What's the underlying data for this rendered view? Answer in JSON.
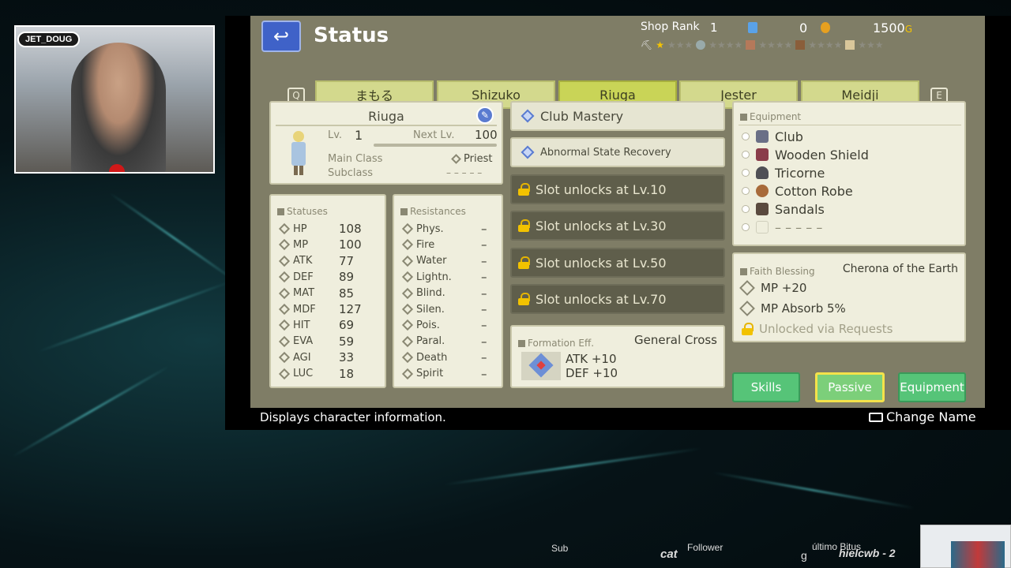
{
  "stream": {
    "cam_name": "JET_DOUG",
    "footer": {
      "sub": "Sub",
      "cat": "cat",
      "follower": "Follower",
      "g": "g",
      "ultimo": "último Bitus",
      "name": "hielcwb - 2"
    }
  },
  "game": {
    "title": "Status",
    "shop": {
      "label": "Shop Rank",
      "rank": "1",
      "gems": "0",
      "gold": "1500",
      "gold_unit": "G"
    },
    "tabs": [
      {
        "label": "まもる",
        "key": ""
      },
      {
        "label": "Shizuko"
      },
      {
        "label": "Riuga",
        "active": true
      },
      {
        "label": "Jester"
      },
      {
        "label": "Meidji"
      }
    ],
    "tab_prev_key": "Q",
    "tab_next_key": "E",
    "character": {
      "name": "Riuga",
      "lv_label": "Lv.",
      "lv": "1",
      "next_label": "Next Lv.",
      "next": "100",
      "main_class_label": "Main Class",
      "main_class": "Priest",
      "subclass_label": "Subclass",
      "subclass": "– – – – –"
    },
    "statuses": {
      "header": "Statuses",
      "rows": [
        {
          "name": "HP",
          "value": "108"
        },
        {
          "name": "MP",
          "value": "100"
        },
        {
          "name": "ATK",
          "value": "77"
        },
        {
          "name": "DEF",
          "value": "89"
        },
        {
          "name": "MAT",
          "value": "85"
        },
        {
          "name": "MDF",
          "value": "127"
        },
        {
          "name": "HIT",
          "value": "69"
        },
        {
          "name": "EVA",
          "value": "59"
        },
        {
          "name": "AGI",
          "value": "33"
        },
        {
          "name": "LUC",
          "value": "18"
        }
      ]
    },
    "resistances": {
      "header": "Resistances",
      "rows": [
        {
          "name": "Phys.",
          "value": "–"
        },
        {
          "name": "Fire",
          "value": "–"
        },
        {
          "name": "Water",
          "value": "–"
        },
        {
          "name": "Lightn.",
          "value": "–"
        },
        {
          "name": "Blind.",
          "value": "–"
        },
        {
          "name": "Silen.",
          "value": "–"
        },
        {
          "name": "Pois.",
          "value": "–"
        },
        {
          "name": "Paral.",
          "value": "–"
        },
        {
          "name": "Death",
          "value": "–"
        },
        {
          "name": "Spirit",
          "value": "–"
        }
      ]
    },
    "passives": [
      {
        "label": "Club Mastery"
      },
      {
        "label": "Abnormal State Recovery"
      },
      {
        "label": "Slot unlocks at Lv.10"
      },
      {
        "label": "Slot unlocks at Lv.30"
      },
      {
        "label": "Slot unlocks at Lv.50"
      },
      {
        "label": "Slot unlocks at Lv.70"
      }
    ],
    "formation": {
      "header": "Formation Eff.",
      "name": "General Cross",
      "line1": "ATK +10",
      "line2": "DEF +10"
    },
    "equipment": {
      "header": "Equipment",
      "items": [
        "Club",
        "Wooden Shield",
        "Tricorne",
        "Cotton Robe",
        "Sandals",
        "– – – – –"
      ]
    },
    "faith": {
      "header": "Faith Blessing",
      "name": "Cherona of the Earth",
      "b1": "MP +20",
      "b2": "MP Absorb 5%",
      "b3": "Unlocked via Requests"
    },
    "buttons": {
      "skills": "Skills",
      "passive": "Passive",
      "equipment": "Equipment"
    },
    "help": "Displays character information.",
    "change_name": "Change Name"
  }
}
